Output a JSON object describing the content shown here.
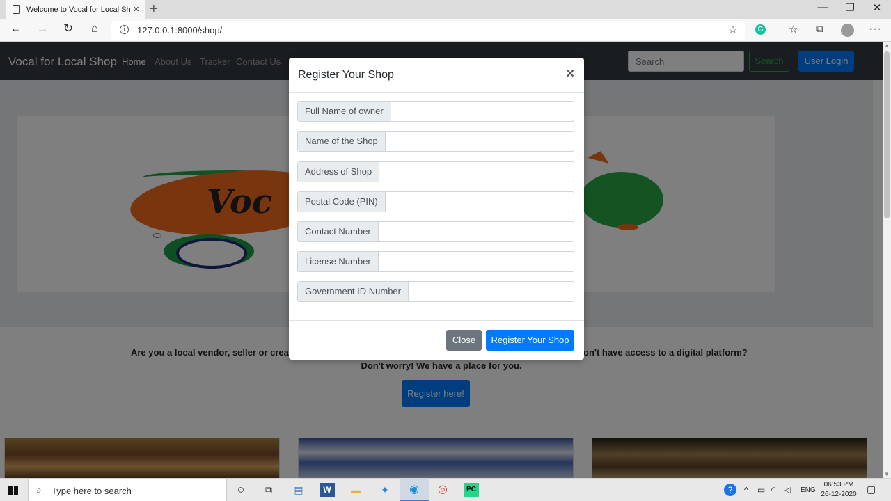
{
  "browser": {
    "tab_title": "Welcome to Vocal for Local Shop",
    "url": "127.0.0.1:8000/shop/"
  },
  "site": {
    "brand": "Vocal for Local Shop",
    "nav": [
      "Home",
      "About Us",
      "Tracker",
      "Contact Us"
    ],
    "search_placeholder": "Search",
    "search_button": "Search",
    "login_button": "User Login",
    "banner_word": "Voc",
    "lead_line1_left": "Are you a local vendor, seller or creat",
    "lead_line1_right": "on't have access to a digital platform?",
    "lead_line2": "Don't worry! We have a place for you.",
    "register_here": "Register here!"
  },
  "modal": {
    "title": "Register Your Shop",
    "close_symbol": "×",
    "fields": [
      {
        "label": "Full Name of owner",
        "value": ""
      },
      {
        "label": "Name of the Shop",
        "value": ""
      },
      {
        "label": "Address of Shop",
        "value": ""
      },
      {
        "label": "Postal Code (PIN)",
        "value": ""
      },
      {
        "label": "Contact Number",
        "value": ""
      },
      {
        "label": "License Number",
        "value": ""
      },
      {
        "label": "Government ID Number",
        "value": ""
      }
    ],
    "close_button": "Close",
    "submit_button": "Register Your Shop"
  },
  "taskbar": {
    "search_placeholder": "Type here to search",
    "language": "ENG",
    "time": "06:53 PM",
    "date": "26-12-2020"
  },
  "colors": {
    "primary": "#007bff",
    "secondary": "#6c757d",
    "success": "#28a745",
    "navbar": "#343a40"
  }
}
